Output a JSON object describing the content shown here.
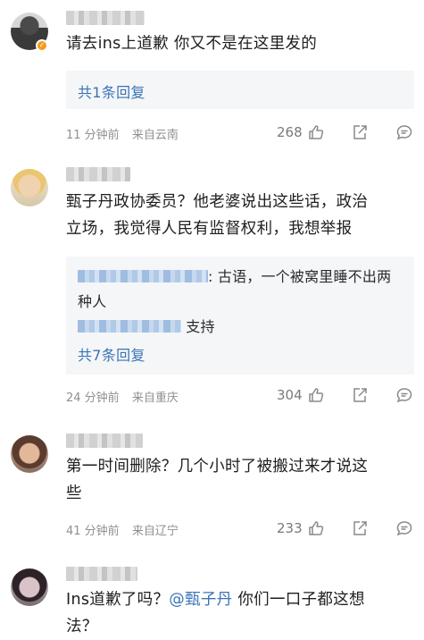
{
  "comments": [
    {
      "text": "请去ins上道歉 你又不是在这里发的",
      "reply_count": "共1条回复",
      "time": "11 分钟前",
      "location": "来自云南",
      "likes": "268",
      "verified_badge": true
    },
    {
      "text_line1": "甄子丹政协委员？他老婆说出这些话，政治",
      "text_line2": "立场，我觉得人民有监督权利，我想举报",
      "replies": [
        {
          "text_a": ": 古语，一个被窝里睡不出两",
          "text_b": "种人"
        },
        {
          "text_a": " 支持"
        }
      ],
      "reply_count": "共7条回复",
      "time": "24 分钟前",
      "location": "来自重庆",
      "likes": "304"
    },
    {
      "text_line1": "第一时间删除？几个小时了被搬过来才说这",
      "text_line2": "些",
      "time": "41 分钟前",
      "location": "来自辽宁",
      "likes": "233"
    },
    {
      "text_before": "Ins道歉了吗？",
      "mention": "@甄子丹",
      "text_after": " 你们一口子都这想",
      "text_line2": "法？"
    }
  ],
  "icons": {
    "like": "thumbs-up-icon",
    "share": "share-icon",
    "comment": "comment-icon"
  },
  "colors": {
    "link": "#3b74b5",
    "meta": "#909090",
    "reply_bg": "#f4f6f8"
  }
}
